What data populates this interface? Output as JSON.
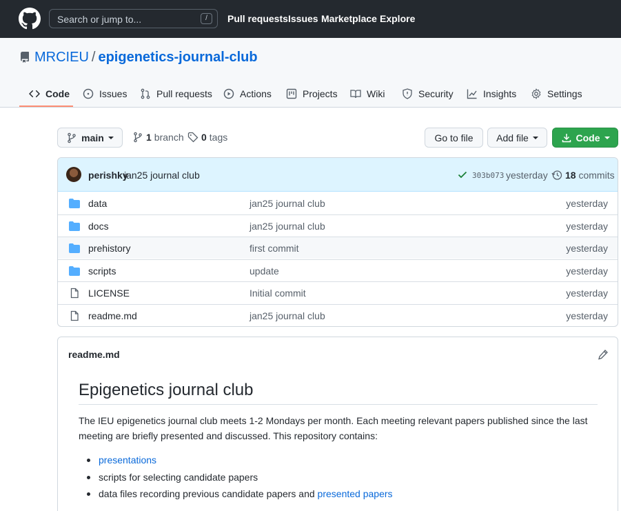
{
  "header": {
    "search_placeholder": "Search or jump to...",
    "slash_key": "/",
    "nav": [
      "Pull requests",
      "Issues",
      "Marketplace",
      "Explore"
    ]
  },
  "repo": {
    "owner": "MRCIEU",
    "separator": "/",
    "name": "epigenetics-journal-club"
  },
  "tabs": [
    {
      "label": "Code",
      "icon": "code-icon"
    },
    {
      "label": "Issues",
      "icon": "issue-icon"
    },
    {
      "label": "Pull requests",
      "icon": "pull-request-icon"
    },
    {
      "label": "Actions",
      "icon": "play-icon"
    },
    {
      "label": "Projects",
      "icon": "project-icon"
    },
    {
      "label": "Wiki",
      "icon": "book-icon"
    },
    {
      "label": "Security",
      "icon": "shield-icon"
    },
    {
      "label": "Insights",
      "icon": "graph-icon"
    },
    {
      "label": "Settings",
      "icon": "gear-icon"
    }
  ],
  "toolbar": {
    "branch": "main",
    "branches_count": "1",
    "branches_label": "branch",
    "tags_count": "0",
    "tags_label": "tags",
    "go_to_file": "Go to file",
    "add_file": "Add file",
    "code": "Code"
  },
  "commit": {
    "author": "perishky",
    "message": "jan25 journal club",
    "sha": "303b073",
    "time": "yesterday",
    "count": "18",
    "count_label": "commits"
  },
  "files": [
    {
      "type": "folder",
      "name": "data",
      "message": "jan25 journal club",
      "age": "yesterday"
    },
    {
      "type": "folder",
      "name": "docs",
      "message": "jan25 journal club",
      "age": "yesterday"
    },
    {
      "type": "folder",
      "name": "prehistory",
      "message": "first commit",
      "age": "yesterday"
    },
    {
      "type": "folder",
      "name": "scripts",
      "message": "update",
      "age": "yesterday"
    },
    {
      "type": "file",
      "name": "LICENSE",
      "message": "Initial commit",
      "age": "yesterday"
    },
    {
      "type": "file",
      "name": "readme.md",
      "message": "jan25 journal club",
      "age": "yesterday"
    }
  ],
  "readme": {
    "filename": "readme.md",
    "heading": "Epigenetics journal club",
    "paragraph": "The IEU epigenetics journal club meets 1-2 Mondays per month. Each meeting relevant papers published since the last meeting are briefly presented and discussed. This repository contains:",
    "items": [
      {
        "link": "presentations",
        "text": ""
      },
      {
        "link": "",
        "text": "scripts for selecting candidate papers"
      },
      {
        "link": "presented papers",
        "text": "data files recording previous candidate papers and "
      }
    ]
  },
  "colors": {
    "header_bg": "#24292f",
    "link": "#0969da",
    "green_button": "#2da44e",
    "tab_underline": "#fd8c73",
    "commit_bar": "#ddf4ff",
    "folder": "#54aeff"
  }
}
